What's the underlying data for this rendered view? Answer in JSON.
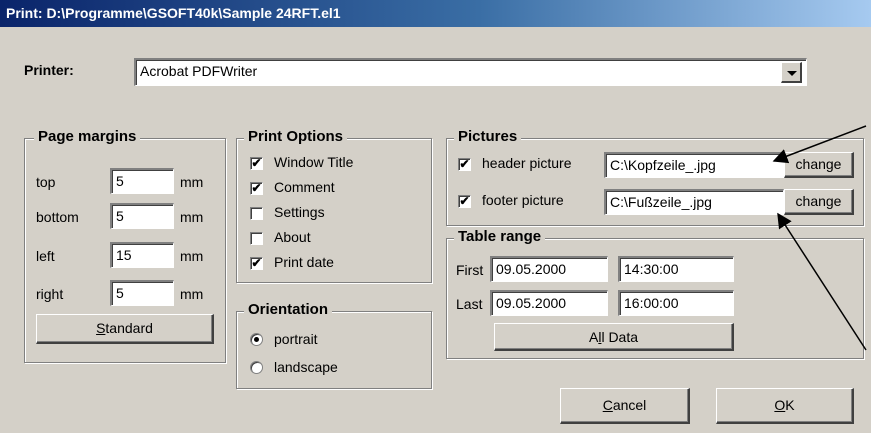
{
  "title": "Print: D:\\Programme\\GSOFT40k\\Sample 24RFT.el1",
  "printer": {
    "label": "Printer:",
    "value": "Acrobat PDFWriter"
  },
  "page_margins": {
    "title": "Page margins",
    "unit": "mm",
    "top": {
      "label": "top",
      "value": "5"
    },
    "bottom": {
      "label": "bottom",
      "value": "5"
    },
    "left": {
      "label": "left",
      "value": "15"
    },
    "right": {
      "label": "right",
      "value": "5"
    },
    "standard_button": {
      "mnemonic": "S",
      "rest": "tandard"
    }
  },
  "print_options": {
    "title": "Print Options",
    "items": [
      {
        "label": "Window Title",
        "checked": true
      },
      {
        "label": "Comment",
        "checked": true
      },
      {
        "label": "Settings",
        "checked": false
      },
      {
        "label": "About",
        "checked": false
      },
      {
        "label": "Print date",
        "checked": true
      }
    ]
  },
  "orientation": {
    "title": "Orientation",
    "portrait": {
      "label": "portrait",
      "selected": true
    },
    "landscape": {
      "label": "landscape",
      "selected": false
    }
  },
  "pictures": {
    "title": "Pictures",
    "header": {
      "label": "header picture",
      "checked": true,
      "value": "C:\\Kopfzeile_.jpg",
      "button": "change"
    },
    "footer": {
      "label": "footer picture",
      "checked": true,
      "value": "C:\\Fußzeile_.jpg",
      "button": "change"
    }
  },
  "table_range": {
    "title": "Table range",
    "first": {
      "label": "First",
      "date": "09.05.2000",
      "time": "14:30:00"
    },
    "last": {
      "label": "Last",
      "date": "09.05.2000",
      "time": "16:00:00"
    },
    "all_data_button": {
      "pre": "A",
      "mnemonic": "l",
      "rest": "l Data"
    }
  },
  "buttons": {
    "cancel": {
      "mnemonic": "C",
      "rest": "ancel"
    },
    "ok": {
      "mnemonic": "O",
      "rest": "K"
    }
  },
  "check_glyph": "✔"
}
